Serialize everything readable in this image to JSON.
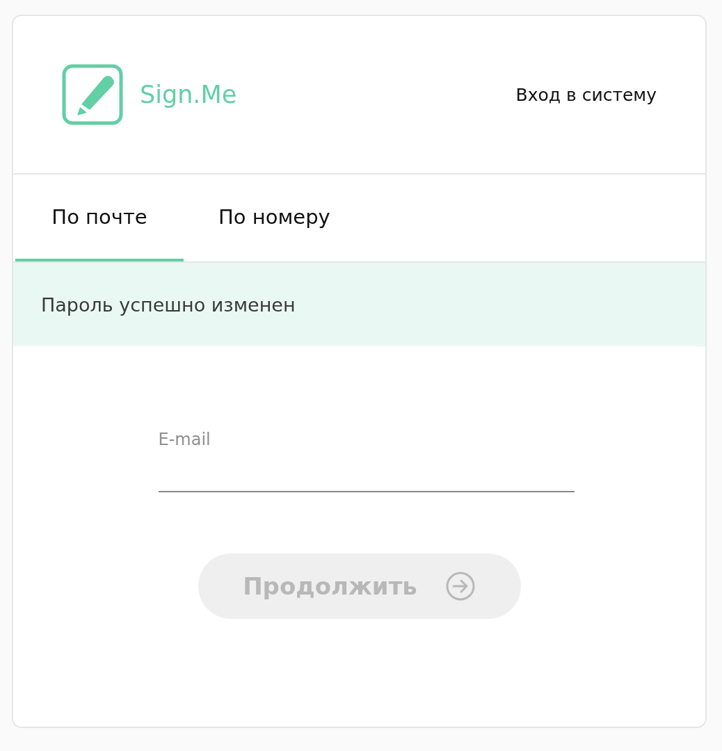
{
  "header": {
    "logo_text": "Sign.Me",
    "login_link": "Вход в систему"
  },
  "tabs": [
    {
      "label": "По почте",
      "selected": true
    },
    {
      "label": "По номеру",
      "selected": false
    }
  ],
  "alert": {
    "text": "Пароль успешно изменен"
  },
  "form": {
    "email": {
      "label": "E-mail"
    },
    "button": {
      "label": "Продолжить",
      "disabled": true
    }
  }
}
